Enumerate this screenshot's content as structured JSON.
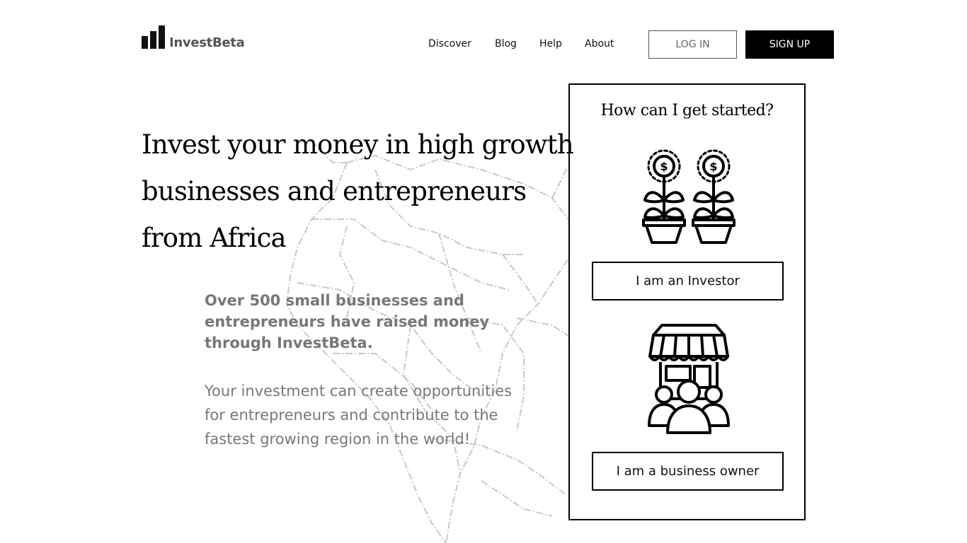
{
  "brand": {
    "name": "InvestBeta"
  },
  "nav": {
    "items": [
      {
        "label": "Discover"
      },
      {
        "label": "Blog"
      },
      {
        "label": "Help"
      },
      {
        "label": "About"
      }
    ],
    "login_label": "LOG IN",
    "signup_label": "SIGN UP"
  },
  "hero": {
    "headline_lines": [
      "Invest your money in high growth",
      "businesses and entrepreneurs",
      "from Africa"
    ],
    "lead_bold": "Over 500 small businesses and entrepreneurs have raised money through InvestBeta.",
    "lead": "Your investment can create opportunities for entrepreneurs and contribute to the fastest growing region in the world!"
  },
  "card": {
    "title": "How can I get started?",
    "investor_button": "I am an Investor",
    "owner_button": "I am a business owner"
  },
  "icons": [
    "logo-bars-icon",
    "money-plant-icon",
    "shop-people-icon",
    "africa-map-illustration"
  ],
  "colors": {
    "accent": "#000000",
    "muted_text": "#777777",
    "logo_text": "#555555"
  }
}
